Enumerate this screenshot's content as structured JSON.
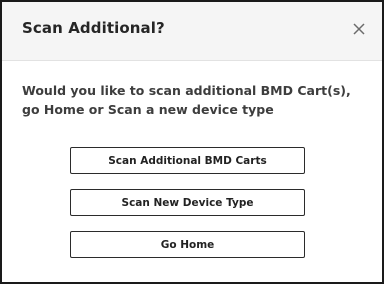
{
  "dialog": {
    "title": "Scan Additional?",
    "close_icon": "close-icon",
    "message": "Would you like to scan additional BMD Cart(s), go Home or Scan a new device type",
    "buttons": [
      {
        "label": "Scan Additional BMD Carts"
      },
      {
        "label": "Scan New Device Type"
      },
      {
        "label": "Go Home"
      }
    ]
  },
  "colors": {
    "header_bg": "#f5f5f5",
    "border": "#1a1a1a",
    "text": "#262626"
  }
}
